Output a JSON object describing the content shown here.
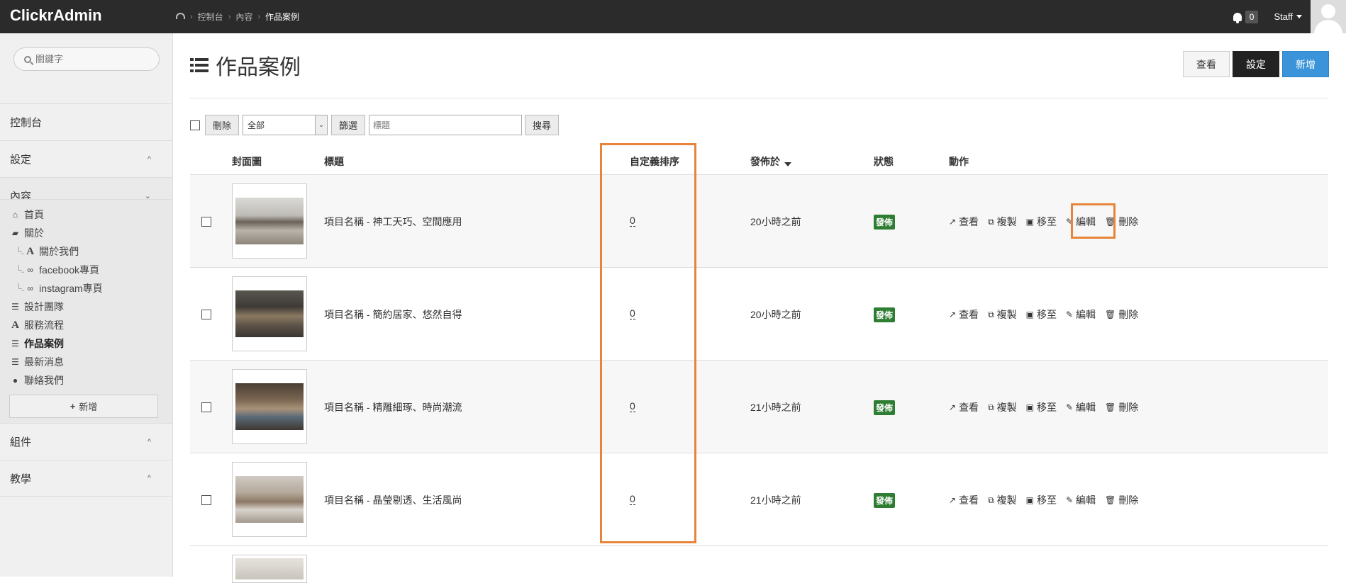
{
  "brand": "ClickrAdmin",
  "breadcrumb": {
    "items": [
      "控制台",
      "內容"
    ],
    "current": "作品案例"
  },
  "notifications": {
    "count": "0"
  },
  "user": {
    "name": "Staff"
  },
  "sidebar": {
    "search_placeholder": "關鍵字",
    "sections": {
      "dashboard": "控制台",
      "settings": "設定",
      "content": "內容",
      "components": "組件",
      "tutorial": "教學"
    },
    "content_links": [
      {
        "label": "首頁",
        "icon": "home-icon"
      },
      {
        "label": "關於",
        "icon": "folder-open-icon"
      },
      {
        "label": "關於我們",
        "icon": "font-icon"
      },
      {
        "label": "facebook專頁",
        "icon": "link-icon"
      },
      {
        "label": "instagram專頁",
        "icon": "link-icon"
      },
      {
        "label": "設計團隊",
        "icon": "list-icon"
      },
      {
        "label": "服務流程",
        "icon": "font-icon"
      },
      {
        "label": "作品案例",
        "icon": "list-icon"
      },
      {
        "label": "最新消息",
        "icon": "list-icon"
      },
      {
        "label": "聯絡我們",
        "icon": "map-marker-icon"
      }
    ],
    "add_label": "新增"
  },
  "page": {
    "title": "作品案例",
    "buttons": {
      "view": "查看",
      "settings": "設定",
      "new": "新增"
    }
  },
  "toolbar": {
    "delete_label": "刪除",
    "filter_value": "全部",
    "filter_button": "篩選",
    "keyword_placeholder": "標題",
    "search_button": "搜尋"
  },
  "table": {
    "headers": {
      "cover": "封面圖",
      "title": "標題",
      "order": "自定義排序",
      "published": "發佈於",
      "status": "狀態",
      "actions": "動作"
    },
    "action_labels": {
      "view": "查看",
      "copy": "複製",
      "move": "移至",
      "edit": "編輯",
      "delete": "刪除"
    },
    "rows": [
      {
        "title": "項目名稱 - 神工天巧、空間應用",
        "order": "0",
        "time": "20小時之前",
        "status": "發佈"
      },
      {
        "title": "項目名稱 - 簡約居家、悠然自得",
        "order": "0",
        "time": "20小時之前",
        "status": "發佈"
      },
      {
        "title": "項目名稱 - 精雕細琢、時尚潮流",
        "order": "0",
        "time": "21小時之前",
        "status": "發佈"
      },
      {
        "title": "項目名稱 - 晶瑩剔透、生活風尚",
        "order": "0",
        "time": "21小時之前",
        "status": "發佈"
      }
    ]
  },
  "colors": {
    "topbar": "#2b2b2b",
    "primary": "#3b94d9",
    "published": "#2e7d32",
    "highlight": "#e8843a"
  }
}
